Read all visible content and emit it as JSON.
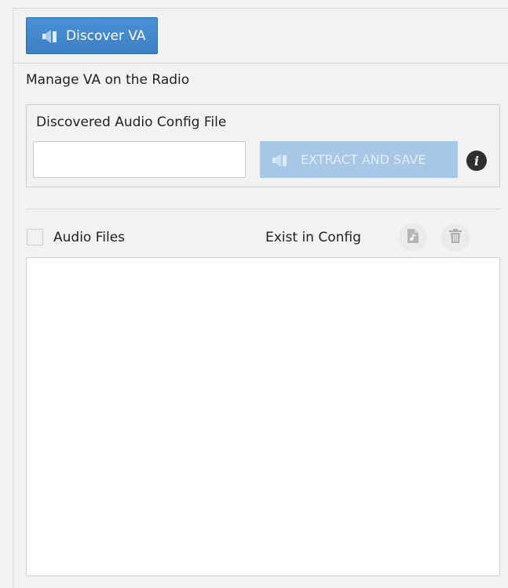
{
  "toolbar": {
    "discover_label": "Discover VA"
  },
  "manage": {
    "title": "Manage VA on the Radio",
    "config_label": "Discovered Audio Config File",
    "config_value": "",
    "extract_label": "EXTRACT AND SAVE"
  },
  "files": {
    "col_audio": "Audio Files",
    "col_exist": "Exist in Config",
    "rows": []
  },
  "icons": {
    "discover": "speaker-icon",
    "extract": "speaker-icon",
    "info": "info-icon",
    "file": "music-file-icon",
    "trash": "trash-icon"
  },
  "colors": {
    "primary_button": "#3d7fc4",
    "disabled_button": "#a6c7e6",
    "background": "#f2f2f2"
  }
}
